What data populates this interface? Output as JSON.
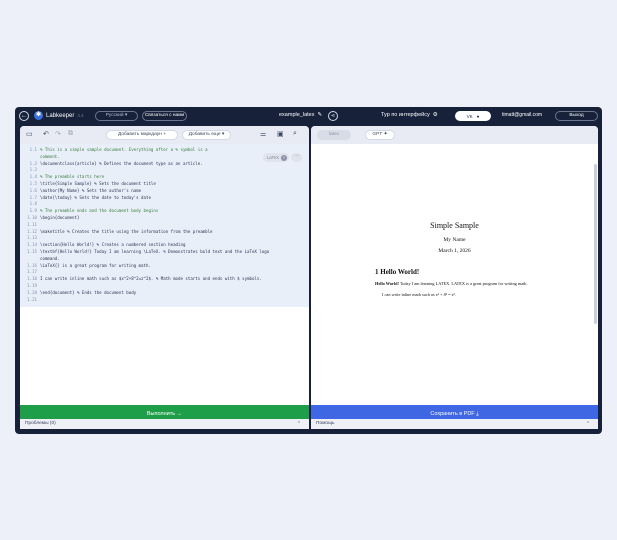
{
  "header": {
    "back": "←",
    "logo_mark": "✱",
    "logo_text": "Labkeeper",
    "logo_version": "4.4",
    "language": "Русский",
    "contact": "Связаться с нами",
    "filename": "example_latex",
    "tour": "Тур по интерфейсу",
    "vk": "VK",
    "email": "timatt@gmail.com",
    "logout": "Выход"
  },
  "toolbar": {
    "add_markdown": "Добавить маркдаун",
    "add_more": "Добавить еще"
  },
  "editor": {
    "badge": "LaTeX",
    "lines": [
      {
        "n": "1.1",
        "t": "% This is a simple sample document. Everything after a % symbol is a",
        "c": "cm"
      },
      {
        "n": "",
        "t": "comment.",
        "c": "cm"
      },
      {
        "n": "1.2",
        "t": "\\documentclass{article} % Defines the document type as an article.",
        "c": ""
      },
      {
        "n": "1.3",
        "t": "",
        "c": ""
      },
      {
        "n": "1.4",
        "t": "% The preamble starts here",
        "c": "cm"
      },
      {
        "n": "1.5",
        "t": "\\title{Simple Sample} % Sets the document title",
        "c": ""
      },
      {
        "n": "1.6",
        "t": "\\author{My Name} % Sets the author's name",
        "c": ""
      },
      {
        "n": "1.7",
        "t": "\\date{\\today} % Sets the date to today's date",
        "c": ""
      },
      {
        "n": "1.8",
        "t": "",
        "c": ""
      },
      {
        "n": "1.9",
        "t": "% The preamble ends and the document body begins",
        "c": "cm"
      },
      {
        "n": "1.10",
        "t": "\\begin{document}",
        "c": ""
      },
      {
        "n": "1.11",
        "t": "",
        "c": ""
      },
      {
        "n": "1.12",
        "t": "\\maketitle % Creates the title using the information from the preamble",
        "c": ""
      },
      {
        "n": "1.13",
        "t": "",
        "c": ""
      },
      {
        "n": "1.14",
        "t": "\\section{Hello World!} % Creates a numbered section heading",
        "c": ""
      },
      {
        "n": "1.15",
        "t": "\\textbf{Hello World!} Today I am learning \\LaTeX. % Demonstrates bold text and the LaTeX logo",
        "c": ""
      },
      {
        "n": "",
        "t": "command.",
        "c": ""
      },
      {
        "n": "1.16",
        "t": "\\LaTeX{} is a great program for writing math.",
        "c": ""
      },
      {
        "n": "1.17",
        "t": "",
        "c": ""
      },
      {
        "n": "1.18",
        "t": "I can write inline math such as $x^2+8^2=z^2$. % Math mode starts and ends with $ symbols.",
        "c": ""
      },
      {
        "n": "1.19",
        "t": "",
        "c": ""
      },
      {
        "n": "1.20",
        "t": "\\end{document} % Ends the document body",
        "c": ""
      },
      {
        "n": "1.21",
        "t": "",
        "c": ""
      }
    ],
    "run": "Выполнить →"
  },
  "preview": {
    "tab_latex": "latex",
    "tab_gpt": "GPT",
    "title": "Simple Sample",
    "author": "My Name",
    "date": "March 1, 2026",
    "section": "1   Hello World!",
    "para1_bold": "Hello World!",
    "para1": " Today I am learning LATEX. LATEX is a great program for writing math.",
    "para2": "I can write inline math such as x² + 8² = z².",
    "save": "Сохранить в PDF ⤓"
  },
  "footer": {
    "problems": "Проблемы (0)",
    "help": "Помощь"
  }
}
